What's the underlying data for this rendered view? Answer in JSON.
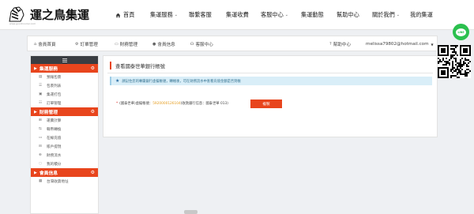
{
  "logo": {
    "brand_text": "運之鳥集運",
    "subtitle": "www.goodcourier.com"
  },
  "nav": {
    "items": [
      {
        "label": "首頁",
        "icon": "home-icon",
        "has_dropdown": false
      },
      {
        "label": "集運服務",
        "has_dropdown": true
      },
      {
        "label": "聯繫客服",
        "has_dropdown": false
      },
      {
        "label": "集運收費",
        "has_dropdown": false
      },
      {
        "label": "客服中心",
        "has_dropdown": true
      },
      {
        "label": "集運動態",
        "has_dropdown": false
      },
      {
        "label": "幫助中心",
        "has_dropdown": false
      },
      {
        "label": "關於我們",
        "has_dropdown": true
      },
      {
        "label": "我的集運",
        "has_dropdown": false
      }
    ]
  },
  "member_bar": {
    "items": [
      {
        "label": "會員首頁",
        "icon": "home-icon"
      },
      {
        "label": "訂單管理",
        "icon": "gear-icon"
      },
      {
        "label": "財務管理",
        "icon": "money-icon"
      },
      {
        "label": "會員信息",
        "icon": "user-icon"
      },
      {
        "label": "客服中心",
        "icon": "headset-icon"
      }
    ],
    "help": {
      "label": "幫助中心",
      "icon": "question-icon"
    },
    "user_email": "melissa79802@hotmail.com"
  },
  "sidebar": {
    "sections": [
      {
        "title": "集運服務",
        "items": [
          "預報包裹",
          "包裹列表",
          "集運打包",
          "訂單管理"
        ]
      },
      {
        "title": "財務管理",
        "items": [
          "運費計算",
          "韓幣轉換",
          "在線充值",
          "賬戶提現",
          "財務流水",
          "我的積分"
        ]
      },
      {
        "title": "會員信息",
        "items": [
          "台灣收貨地址"
        ]
      }
    ]
  },
  "main": {
    "title": "查看國泰世華銀行帳號",
    "notice": "請記住您的專屬銀行虛擬帳號，轉帳後，可在財務流水中查看充值金額是否到帳",
    "account_prefix": "(國泰世華)虛擬帳號：",
    "account_number": "5920000126104",
    "account_suffix": " (收款銀行信息：國泰世華 013)",
    "copy_button": "複製"
  },
  "widgets": {
    "line_label": "LINE"
  },
  "colors": {
    "accent": "#e8451d",
    "notice_bg": "#d9eef8",
    "line_green": "#2bc04e",
    "account_number": "#e59c1d"
  }
}
